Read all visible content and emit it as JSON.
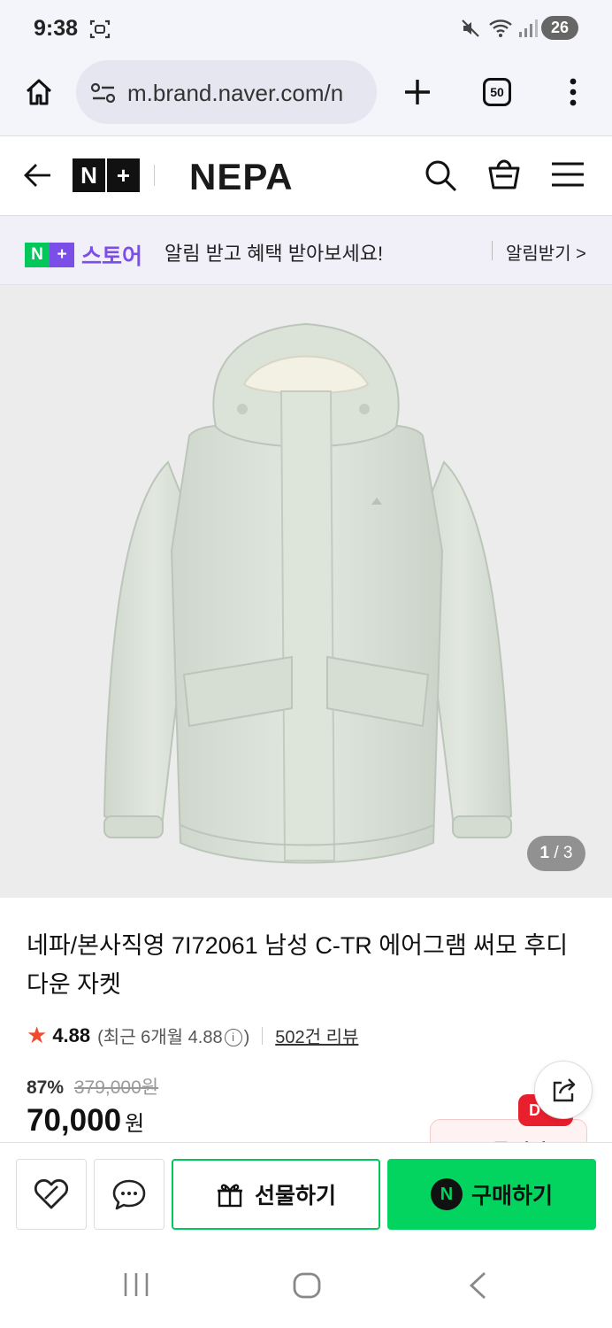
{
  "status_bar": {
    "time": "9:38",
    "battery": "26"
  },
  "browser": {
    "url": "m.brand.naver.com/n",
    "tab_count": "50"
  },
  "site_header": {
    "naver_plus_badge": [
      "N",
      "+"
    ],
    "brand": "NEPA"
  },
  "notify_banner": {
    "badge_n": "N",
    "badge_plus": "+",
    "store_label": "스토어",
    "message": "알림 받고 혜택 받아보세요!",
    "action": "알림받기 >"
  },
  "gallery": {
    "current": "1",
    "separator": "/",
    "total": "3"
  },
  "product": {
    "title": "네파/본사직영 7I72061 남성 C-TR 에어그램 써모 후디 다운 자켓",
    "rating": "4.88",
    "recent_open": "(최근 6개월 4.88",
    "recent_close": ")",
    "info_icon": "i",
    "reviews": "502건 리뷰",
    "discount_pct": "87%",
    "original_price": "379,000원",
    "price": "70,000",
    "currency": "원",
    "coupon_tag": "D",
    "coupon_label": "쿠폰 받기"
  },
  "purchase_bar": {
    "gift_label": "선물하기",
    "buy_badge": "N",
    "buy_label": "구매하기"
  },
  "colors": {
    "naver_green": "#03c75a",
    "plus_purple": "#7b4ee8",
    "star_red": "#f04a2f",
    "coupon_red": "#e81f2d"
  }
}
